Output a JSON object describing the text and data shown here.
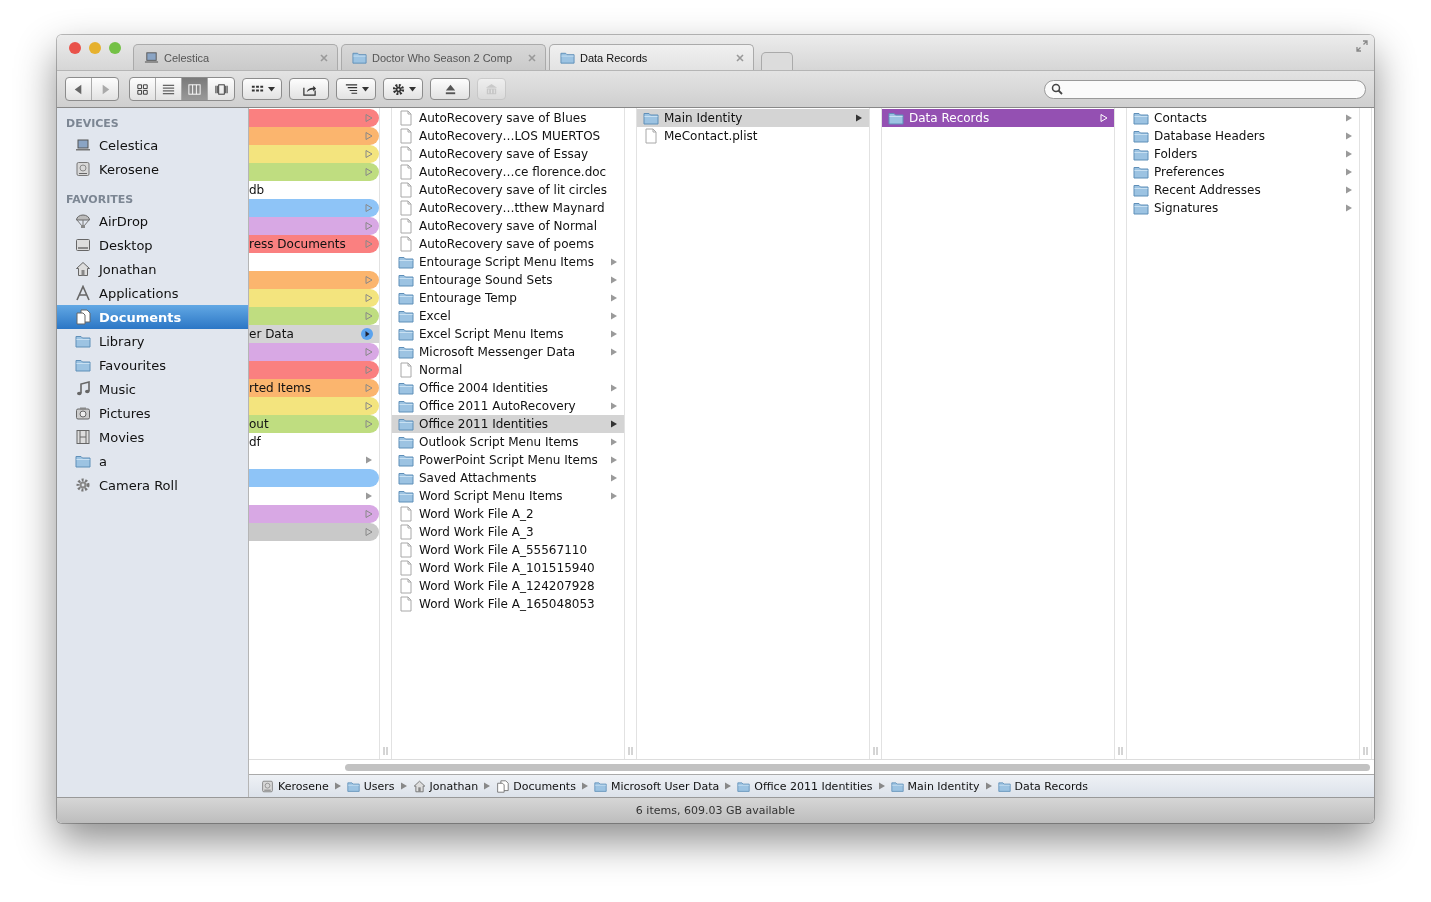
{
  "window": {
    "tabs": [
      {
        "label": "Celestica",
        "kind": "laptop",
        "selected": false
      },
      {
        "label": "Doctor Who Season 2 Comp",
        "kind": "folder",
        "selected": false
      },
      {
        "label": "Data Records",
        "kind": "folder",
        "selected": true
      }
    ]
  },
  "toolbar": {
    "view_modes": [
      {
        "kind": "icons",
        "selected": false
      },
      {
        "kind": "list",
        "selected": false
      },
      {
        "kind": "columns",
        "selected": true
      },
      {
        "kind": "coverflow",
        "selected": false
      }
    ],
    "buttons": [
      {
        "kind": "arrange",
        "disabled": false
      },
      {
        "kind": "share",
        "disabled": false
      },
      {
        "kind": "sort",
        "disabled": false
      },
      {
        "kind": "action",
        "disabled": false
      },
      {
        "kind": "eject",
        "disabled": false
      },
      {
        "kind": "burn",
        "disabled": true
      }
    ]
  },
  "sidebar": {
    "sections": [
      {
        "title": "DEVICES",
        "items": [
          {
            "label": "Celestica",
            "kind": "laptop",
            "selected": false
          },
          {
            "label": "Kerosene",
            "kind": "drive",
            "selected": false
          }
        ]
      },
      {
        "title": "FAVORITES",
        "items": [
          {
            "label": "AirDrop",
            "kind": "airdrop",
            "selected": false
          },
          {
            "label": "Desktop",
            "kind": "desktop",
            "selected": false
          },
          {
            "label": "Jonathan",
            "kind": "home",
            "selected": false
          },
          {
            "label": "Applications",
            "kind": "apps",
            "selected": false
          },
          {
            "label": "Documents",
            "kind": "documents",
            "selected": true
          },
          {
            "label": "Library",
            "kind": "folder",
            "selected": false
          },
          {
            "label": "Favourites",
            "kind": "folder",
            "selected": false
          },
          {
            "label": "Music",
            "kind": "music",
            "selected": false
          },
          {
            "label": "Pictures",
            "kind": "camera",
            "selected": false
          },
          {
            "label": "Movies",
            "kind": "film",
            "selected": false
          },
          {
            "label": "a",
            "kind": "folder",
            "selected": false
          },
          {
            "label": "Camera Roll",
            "kind": "gear",
            "selected": false
          }
        ]
      }
    ]
  },
  "columns": [
    {
      "items": [
        {
          "color": "#fa8080",
          "has_children": true,
          "selected": false
        },
        {
          "color": "#fbb56e",
          "has_children": true,
          "selected": false
        },
        {
          "color": "#f3e47e",
          "has_children": true,
          "selected": false
        },
        {
          "color": "#bfdd80",
          "has_children": true,
          "selected": false
        },
        {
          "label": "db",
          "has_children": false,
          "selected": false
        },
        {
          "color": "#8ec4f7",
          "has_children": true,
          "selected": false
        },
        {
          "color": "#d8a8e4",
          "has_children": true,
          "selected": false
        },
        {
          "label": "ress Documents",
          "color": "#fa8080",
          "has_children": true,
          "selected": false
        },
        {
          "has_children": false,
          "selected": false
        },
        {
          "color": "#fbb56e",
          "has_children": true,
          "selected": false
        },
        {
          "color": "#f3e47e",
          "has_children": true,
          "selected": false
        },
        {
          "color": "#bfdd80",
          "has_children": true,
          "selected": false
        },
        {
          "label": "er Data",
          "color": "#5ba3ee",
          "has_children": true,
          "selected": true
        },
        {
          "color": "#d8a8e4",
          "has_children": true,
          "selected": false
        },
        {
          "color": "#fa8080",
          "has_children": true,
          "selected": false
        },
        {
          "label": "rted Items",
          "color": "#fbb56e",
          "has_children": true,
          "selected": false
        },
        {
          "color": "#f3e47e",
          "has_children": true,
          "selected": false
        },
        {
          "label": "out",
          "color": "#bfdd80",
          "has_children": true,
          "selected": false
        },
        {
          "label": "df",
          "has_children": false,
          "selected": false
        },
        {
          "has_children": true,
          "selected": false
        },
        {
          "color": "#8ec4f7",
          "has_children": false,
          "selected": false
        },
        {
          "has_children": true,
          "selected": false
        },
        {
          "color": "#d8a8e4",
          "has_children": true,
          "selected": false
        },
        {
          "color": "#c9c9c9",
          "has_children": true,
          "selected": false
        }
      ]
    },
    {
      "items": [
        {
          "label": "AutoRecovery save of Blues",
          "kind": "file",
          "has_children": false,
          "selected": false
        },
        {
          "label": "AutoRecovery…LOS MUERTOS",
          "kind": "file",
          "has_children": false,
          "selected": false
        },
        {
          "label": "AutoRecovery save of Essay",
          "kind": "file",
          "has_children": false,
          "selected": false
        },
        {
          "label": "AutoRecovery…ce florence.doc",
          "kind": "file",
          "has_children": false,
          "selected": false
        },
        {
          "label": "AutoRecovery save of lit circles",
          "kind": "file",
          "has_children": false,
          "selected": false
        },
        {
          "label": "AutoRecovery…tthew Maynard",
          "kind": "file",
          "has_children": false,
          "selected": false
        },
        {
          "label": "AutoRecovery save of Normal",
          "kind": "file",
          "has_children": false,
          "selected": false
        },
        {
          "label": "AutoRecovery save of poems",
          "kind": "file",
          "has_children": false,
          "selected": false
        },
        {
          "label": "Entourage Script Menu Items",
          "kind": "folder",
          "has_children": true,
          "selected": false
        },
        {
          "label": "Entourage Sound Sets",
          "kind": "folder",
          "has_children": true,
          "selected": false
        },
        {
          "label": "Entourage Temp",
          "kind": "folder",
          "has_children": true,
          "selected": false
        },
        {
          "label": "Excel",
          "kind": "folder",
          "has_children": true,
          "selected": false
        },
        {
          "label": "Excel Script Menu Items",
          "kind": "folder",
          "has_children": true,
          "selected": false
        },
        {
          "label": "Microsoft Messenger Data",
          "kind": "folder",
          "has_children": true,
          "selected": false
        },
        {
          "label": "Normal",
          "kind": "file",
          "has_children": false,
          "selected": false
        },
        {
          "label": "Office 2004 Identities",
          "kind": "folder",
          "has_children": true,
          "selected": false
        },
        {
          "label": "Office 2011 AutoRecovery",
          "kind": "folder",
          "has_children": true,
          "selected": false
        },
        {
          "label": "Office 2011 Identities",
          "kind": "folder",
          "has_children": true,
          "selected": true
        },
        {
          "label": "Outlook Script Menu Items",
          "kind": "folder",
          "has_children": true,
          "selected": false
        },
        {
          "label": "PowerPoint Script Menu Items",
          "kind": "folder",
          "has_children": true,
          "selected": false
        },
        {
          "label": "Saved Attachments",
          "kind": "folder",
          "has_children": true,
          "selected": false
        },
        {
          "label": "Word Script Menu Items",
          "kind": "folder",
          "has_children": true,
          "selected": false
        },
        {
          "label": "Word Work File A_2",
          "kind": "file",
          "has_children": false,
          "selected": false
        },
        {
          "label": "Word Work File A_3",
          "kind": "file",
          "has_children": false,
          "selected": false
        },
        {
          "label": "Word Work File A_55567110",
          "kind": "file",
          "has_children": false,
          "selected": false
        },
        {
          "label": "Word Work File A_101515940",
          "kind": "file",
          "has_children": false,
          "selected": false
        },
        {
          "label": "Word Work File A_124207928",
          "kind": "file",
          "has_children": false,
          "selected": false
        },
        {
          "label": "Word Work File A_165048053",
          "kind": "file",
          "has_children": false,
          "selected": false
        }
      ]
    },
    {
      "items": [
        {
          "label": "Main Identity",
          "kind": "folder",
          "has_children": true,
          "selected": true
        },
        {
          "label": "MeContact.plist",
          "kind": "file",
          "has_children": false,
          "selected": false
        }
      ]
    },
    {
      "items": [
        {
          "label": "Data Records",
          "kind": "folder",
          "color": "#9450b2",
          "has_children": true,
          "selected": true
        }
      ]
    },
    {
      "items": [
        {
          "label": "Contacts",
          "kind": "folder",
          "has_children": true,
          "selected": false
        },
        {
          "label": "Database Headers",
          "kind": "folder",
          "has_children": true,
          "selected": false
        },
        {
          "label": "Folders",
          "kind": "folder",
          "has_children": true,
          "selected": false
        },
        {
          "label": "Preferences",
          "kind": "folder",
          "has_children": true,
          "selected": false
        },
        {
          "label": "Recent Addresses",
          "kind": "folder",
          "has_children": true,
          "selected": false
        },
        {
          "label": "Signatures",
          "kind": "folder",
          "has_children": true,
          "selected": false
        }
      ]
    }
  ],
  "path_bar": [
    {
      "label": "Kerosene",
      "kind": "drive"
    },
    {
      "label": "Users",
      "kind": "folder"
    },
    {
      "label": "Jonathan",
      "kind": "home"
    },
    {
      "label": "Documents",
      "kind": "documents"
    },
    {
      "label": "Microsoft User Data",
      "kind": "folder"
    },
    {
      "label": "Office 2011 Identities",
      "kind": "folder"
    },
    {
      "label": "Main Identity",
      "kind": "folder"
    },
    {
      "label": "Data Records",
      "kind": "folder"
    }
  ],
  "status_bar": "6 items, 609.03 GB available"
}
